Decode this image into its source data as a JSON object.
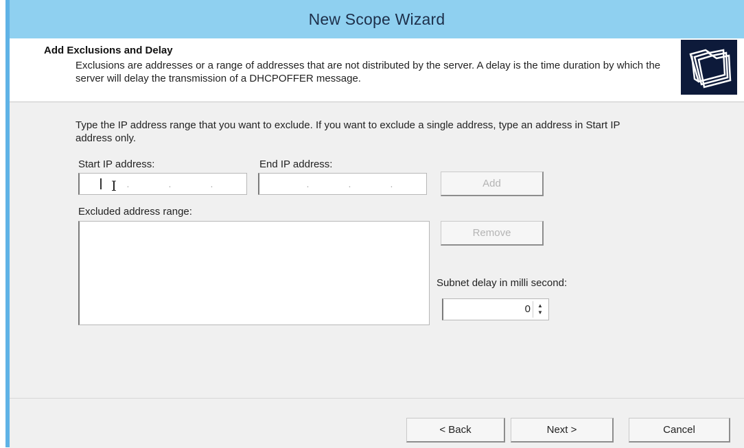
{
  "window": {
    "title": "New Scope Wizard",
    "accent": "#8fd0f0"
  },
  "header": {
    "title": "Add Exclusions and Delay",
    "description": "Exclusions are addresses or a range of addresses that are not distributed by the server. A delay is the time duration by which the server will delay the transmission of a DHCPOFFER message.",
    "icon": "folders-icon"
  },
  "content": {
    "instructions": "Type the IP address range that you want to exclude. If you want to exclude a single address, type an address in Start IP address only.",
    "start_ip_label": "Start IP address:",
    "end_ip_label": "End IP address:",
    "add_button": "Add",
    "excluded_label": "Excluded address range:",
    "excluded_items": [],
    "remove_button": "Remove",
    "subnet_delay_label": "Subnet delay in milli second:",
    "subnet_delay_value": "0"
  },
  "footer": {
    "back_button": "< Back",
    "next_button": "Next >",
    "cancel_button": "Cancel"
  }
}
